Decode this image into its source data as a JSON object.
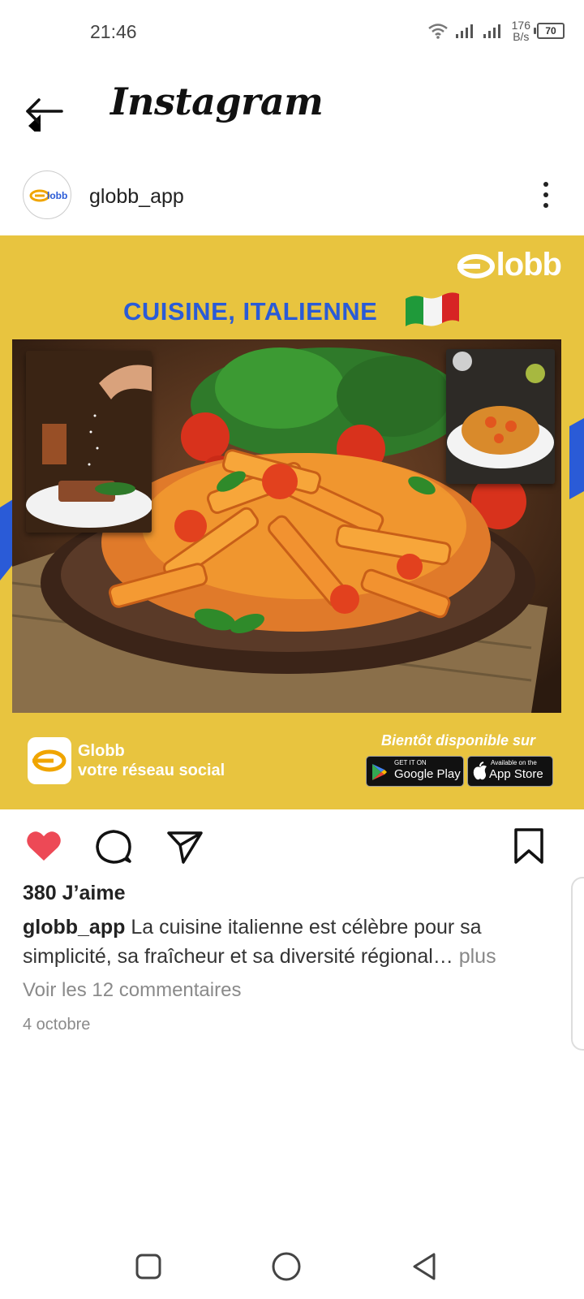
{
  "status_bar": {
    "time": "21:46",
    "net_speed_value": "176",
    "net_speed_unit": "B/s",
    "battery": "70"
  },
  "header": {
    "title": "Instagram"
  },
  "post": {
    "username": "globb_app",
    "image": {
      "logo": "lobb",
      "headline": "CUISINE, ITALIENNE",
      "brand_name": "Globb",
      "brand_tagline": "votre réseau social",
      "coming_soon": "Bientôt disponible sur",
      "google_play_small": "GET IT ON",
      "google_play_big": "Google Play",
      "app_store_small": "Available on the",
      "app_store_big": "App Store"
    },
    "likes": "380 J’aime",
    "caption_user": "globb_app",
    "caption_text": " La cuisine italienne est célèbre pour sa simplicité, sa fraîcheur et sa diversité régional…",
    "caption_more": " plus",
    "comments_link": "Voir les 12 commentaires",
    "date": "4 octobre"
  },
  "colors": {
    "post_background": "#e8c43f",
    "headline_blue": "#2a5bd7",
    "like_red": "#ed4956"
  },
  "icons": [
    "back-arrow-icon",
    "more-options-icon",
    "heart-icon",
    "comment-icon",
    "share-icon",
    "bookmark-icon",
    "wifi-icon",
    "signal-icon",
    "battery-icon",
    "recent-apps-icon",
    "home-icon",
    "back-nav-icon"
  ]
}
